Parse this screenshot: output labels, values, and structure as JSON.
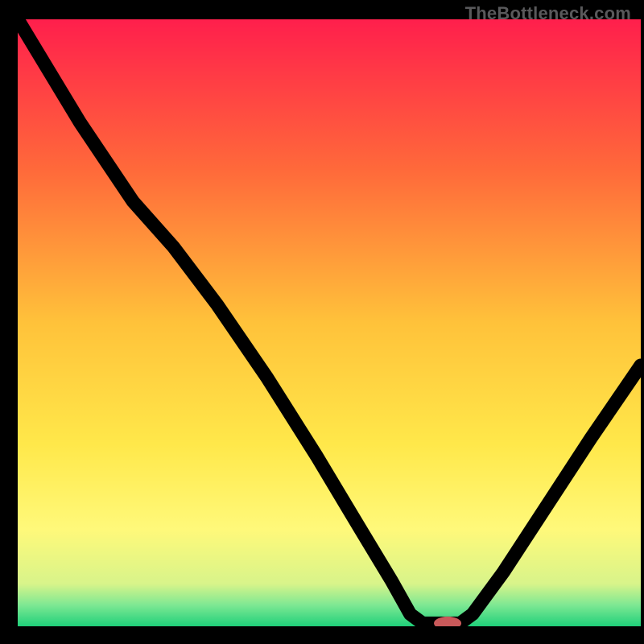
{
  "watermark": "TheBottleneck.com",
  "chart_data": {
    "type": "line",
    "title": "",
    "xlabel": "",
    "ylabel": "",
    "xlim": [
      0,
      100
    ],
    "ylim": [
      0,
      100
    ],
    "grid": false,
    "legend": false,
    "gradient_stops": [
      {
        "offset": 0.0,
        "color": "#ff1f4c"
      },
      {
        "offset": 0.25,
        "color": "#ff6a3a"
      },
      {
        "offset": 0.5,
        "color": "#ffc23a"
      },
      {
        "offset": 0.7,
        "color": "#ffe84a"
      },
      {
        "offset": 0.84,
        "color": "#fff97a"
      },
      {
        "offset": 0.93,
        "color": "#d8f48a"
      },
      {
        "offset": 0.965,
        "color": "#7ee893"
      },
      {
        "offset": 1.0,
        "color": "#1fd07a"
      }
    ],
    "series": [
      {
        "name": "bottleneck-curve",
        "points": [
          {
            "x": 0.0,
            "y": 100.0
          },
          {
            "x": 10.0,
            "y": 83.0
          },
          {
            "x": 18.5,
            "y": 70.0
          },
          {
            "x": 25.0,
            "y": 62.5
          },
          {
            "x": 32.0,
            "y": 53.0
          },
          {
            "x": 40.0,
            "y": 41.0
          },
          {
            "x": 48.0,
            "y": 28.0
          },
          {
            "x": 55.0,
            "y": 16.0
          },
          {
            "x": 60.0,
            "y": 7.5
          },
          {
            "x": 63.0,
            "y": 2.0
          },
          {
            "x": 65.0,
            "y": 0.5
          },
          {
            "x": 71.0,
            "y": 0.5
          },
          {
            "x": 73.0,
            "y": 2.0
          },
          {
            "x": 78.0,
            "y": 9.0
          },
          {
            "x": 85.0,
            "y": 20.0
          },
          {
            "x": 92.0,
            "y": 31.0
          },
          {
            "x": 100.0,
            "y": 43.0
          }
        ]
      }
    ],
    "marker": {
      "x": 69.0,
      "y": 0.5,
      "rx": 2.2,
      "ry": 1.1,
      "color": "#c9595a"
    },
    "annotations": []
  }
}
